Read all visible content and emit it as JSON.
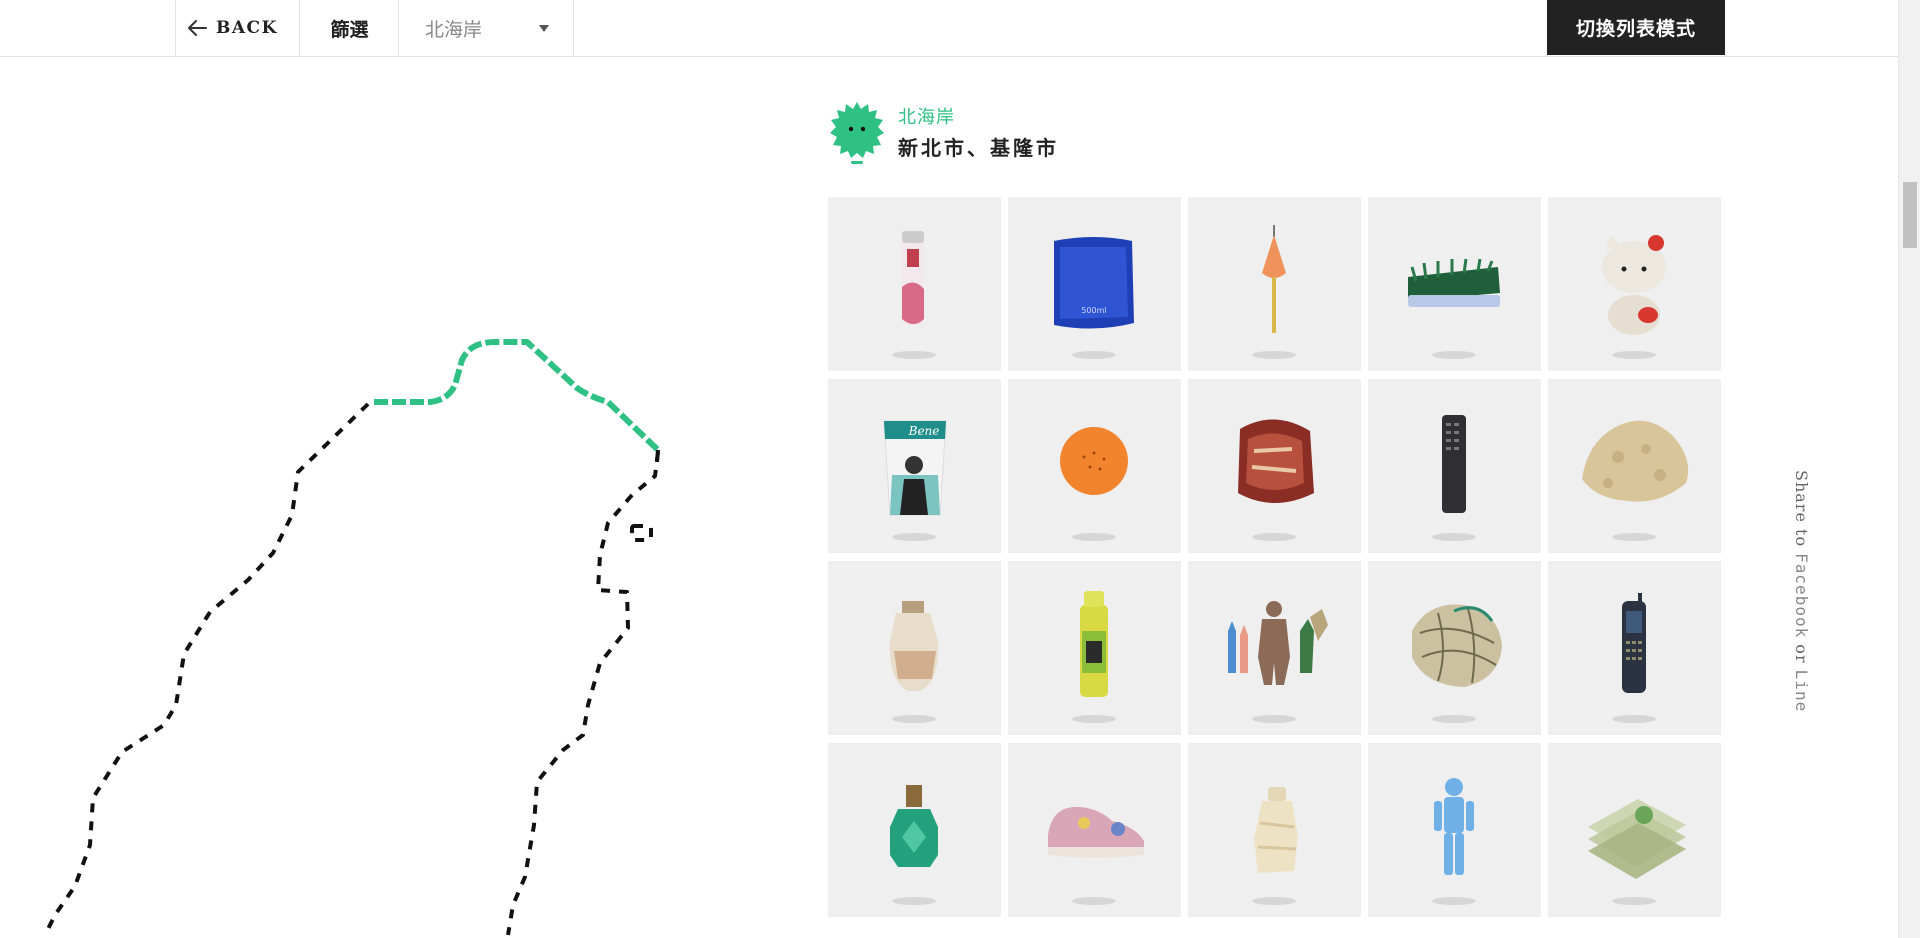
{
  "topbar": {
    "back_label": "BACK",
    "filter_label": "篩選",
    "region_select_value": "北海岸",
    "switch_label": "切換列表模式"
  },
  "region": {
    "name": "北海岸",
    "cities": "新北市、基隆市",
    "accent_color": "#2fc183"
  },
  "items": [
    {
      "icon": "toothpaste-tube-icon"
    },
    {
      "icon": "water-pouch-icon"
    },
    {
      "icon": "fishing-float-icon"
    },
    {
      "icon": "brush-icon"
    },
    {
      "icon": "hello-kitty-doll-icon"
    },
    {
      "icon": "drink-cup-icon"
    },
    {
      "icon": "orange-ball-icon"
    },
    {
      "icon": "snack-bag-icon"
    },
    {
      "icon": "remote-control-icon"
    },
    {
      "icon": "coral-rock-icon"
    },
    {
      "icon": "glass-jar-icon"
    },
    {
      "icon": "spray-can-icon"
    },
    {
      "icon": "toy-soldiers-icon"
    },
    {
      "icon": "fishing-net-icon"
    },
    {
      "icon": "mobile-phone-icon"
    },
    {
      "icon": "perfume-bottle-icon"
    },
    {
      "icon": "sneaker-icon"
    },
    {
      "icon": "plastic-bottle-icon"
    },
    {
      "icon": "action-figure-icon"
    },
    {
      "icon": "food-packs-icon"
    }
  ],
  "item_labels": {
    "water_pouch_volume": "500ml",
    "cup_brand": "Bene"
  },
  "share": {
    "prefix": "Share to ",
    "facebook": "Facebook",
    "or": " or ",
    "line": "Line"
  }
}
